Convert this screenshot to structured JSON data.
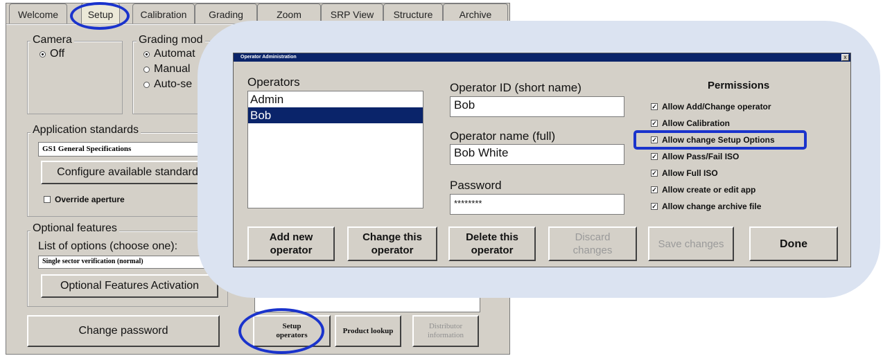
{
  "tabs": [
    "Welcome",
    "Setup",
    "Calibration",
    "Grading",
    "Zoom",
    "SRP View",
    "Structure",
    "Archive"
  ],
  "camera": {
    "legend": "Camera",
    "option": "Off"
  },
  "grading_mode": {
    "legend": "Grading mod",
    "options": [
      "Automat",
      "Manual",
      "Auto-se"
    ]
  },
  "app_standards": {
    "legend": "Application standards",
    "selected": "GS1 General Specifications",
    "configure_button": "Configure available standard",
    "override_label": "Override aperture"
  },
  "optional_features": {
    "legend": "Optional features",
    "list_label": "List of options (choose one):",
    "selected": "Single sector verification (normal)",
    "activation_button": "Optional Features Activation"
  },
  "bottom_buttons": {
    "change_password": "Change password",
    "setup_operators_line1": "Setup",
    "setup_operators_line2": "operators",
    "product_lookup": "Product lookup",
    "distributor_line1": "Distributor",
    "distributor_line2": "information"
  },
  "dialog": {
    "title": "Operator Administration",
    "close": "x",
    "operators_label": "Operators",
    "operators": [
      "Admin",
      "Bob"
    ],
    "selected_operator": "Bob",
    "operator_id_label": "Operator ID (short name)",
    "operator_id_value": "Bob",
    "operator_name_label": "Operator name (full)",
    "operator_name_value": "Bob White",
    "password_label": "Password",
    "password_value": "********",
    "permissions_title": "Permissions",
    "permissions": [
      "Allow Add/Change operator",
      "Allow Calibration",
      "Allow change Setup Options",
      "Allow Pass/Fail ISO",
      "Allow Full ISO",
      "Allow create or edit app",
      "Allow change archive file"
    ],
    "check_mark": "✓",
    "buttons": {
      "add_1": "Add new",
      "add_2": "operator",
      "change_1": "Change this",
      "change_2": "operator",
      "delete_1": "Delete this",
      "delete_2": "operator",
      "discard_1": "Discard",
      "discard_2": "changes",
      "save": "Save changes",
      "done": "Done"
    }
  },
  "colors": {
    "highlight_ring": "#1a33cc",
    "selection": "#0a246a",
    "callout_bg": "#dbe3f1"
  }
}
